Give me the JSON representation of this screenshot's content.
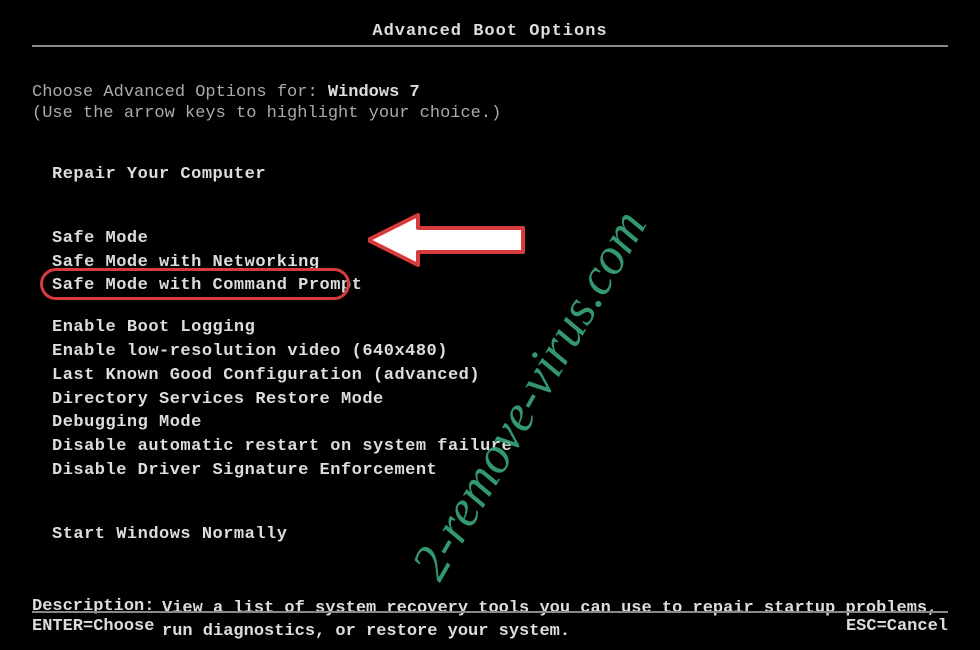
{
  "title": "Advanced Boot Options",
  "choose_prefix": "Choose Advanced Options for: ",
  "os_name": "Windows 7",
  "hint": "(Use the arrow keys to highlight your choice.)",
  "menu": {
    "repair": "Repair Your Computer",
    "safe_mode": "Safe Mode",
    "safe_mode_net": "Safe Mode with Networking",
    "safe_mode_cmd": "Safe Mode with Command Prompt",
    "boot_log": "Enable Boot Logging",
    "low_res": "Enable low-resolution video (640x480)",
    "lkgc": "Last Known Good Configuration (advanced)",
    "ds_restore": "Directory Services Restore Mode",
    "debug": "Debugging Mode",
    "no_auto_restart": "Disable automatic restart on system failure",
    "no_drv_sig": "Disable Driver Signature Enforcement",
    "start_normal": "Start Windows Normally"
  },
  "description_label": "Description:",
  "description_text": "View a list of system recovery tools you can use to repair startup problems, run diagnostics, or restore your system.",
  "footer": {
    "enter": "ENTER=Choose",
    "esc": "ESC=Cancel"
  },
  "watermark": "2-remove-virus.com",
  "annotation": {
    "highlighted_item": "safe_mode_cmd",
    "oval_color": "#d83b3b",
    "arrow_color_fill": "#ffffff",
    "arrow_color_stroke": "#d83b3b"
  }
}
